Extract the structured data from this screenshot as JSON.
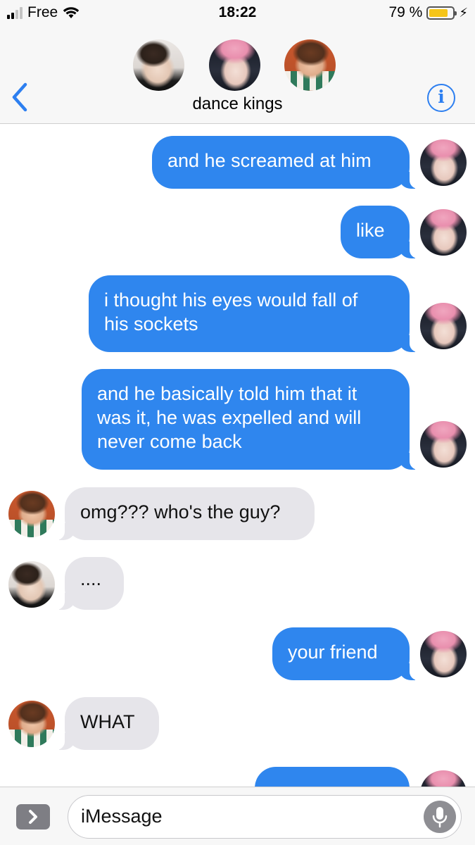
{
  "status_bar": {
    "carrier": "Free",
    "time": "18:22",
    "battery_percent": "79 %",
    "battery_level": 0.79,
    "signal_bars": 4,
    "signal_bars_active": 2
  },
  "header": {
    "title": "dance kings",
    "participants": [
      "jungkook-avatar",
      "jimin-avatar",
      "hoseok-avatar"
    ],
    "back_icon": "chevron-left-icon",
    "info_icon": "info-icon",
    "accent_color": "#2d7ff0"
  },
  "messages": [
    {
      "direction": "outgoing",
      "text": "and he screamed at him",
      "avatar": "jimin"
    },
    {
      "direction": "outgoing",
      "text": "like",
      "avatar": "jimin"
    },
    {
      "direction": "outgoing",
      "text": "i thought his eyes would fall of\nhis sockets",
      "avatar": "jimin"
    },
    {
      "direction": "outgoing",
      "text": "and he basically told him that it\nwas it, he was expelled and will\nnever come back",
      "avatar": "jimin"
    },
    {
      "direction": "incoming",
      "text": "omg??? who's the guy?",
      "avatar": "hoseok"
    },
    {
      "direction": "incoming",
      "text": "....",
      "avatar": "jungkook"
    },
    {
      "direction": "outgoing",
      "text": "your friend",
      "avatar": "jimin"
    },
    {
      "direction": "incoming",
      "text": "WHAT",
      "avatar": "hoseok"
    },
    {
      "direction": "outgoing",
      "text": "",
      "avatar": "jimin"
    }
  ],
  "colors": {
    "outgoing_bubble": "#2f86ee",
    "incoming_bubble": "#e6e5ea"
  },
  "input_bar": {
    "placeholder": "iMessage",
    "apps_icon": "app-store-chevron-icon",
    "mic_icon": "microphone-icon"
  }
}
